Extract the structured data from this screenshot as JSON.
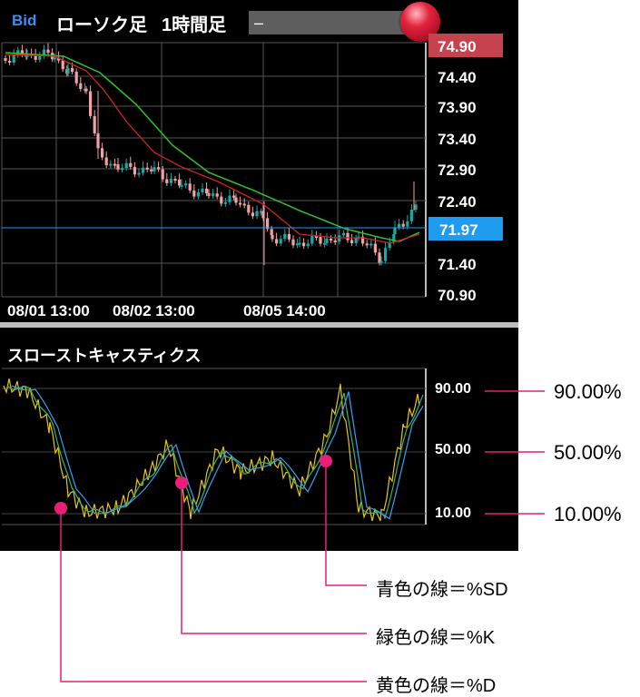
{
  "header": {
    "bid_label": "Bid",
    "chart_type": "ローソク足",
    "timeframe": "1時間足",
    "instrument_value": "–"
  },
  "colors": {
    "ask_line": "#c5424e",
    "current_price": "#1f9bf0",
    "ma_short": "#d42020",
    "ma_long": "#2fc12f",
    "stoch_d": "#e8c414",
    "stoch_k": "#2fb86e",
    "stoch_sd": "#3a9ff0",
    "annotation": "#ea1e78"
  },
  "price_chart": {
    "y_ticks": [
      "74.40",
      "73.90",
      "73.40",
      "72.90",
      "72.40",
      "71.40",
      "70.90"
    ],
    "current_ask": "74.90",
    "current_bid": "71.97",
    "x_labels": [
      "08/01 13:00",
      "08/02 13:00",
      "08/05 14:00"
    ]
  },
  "stochastic": {
    "title": "スローストキャスティクス",
    "y_ticks": [
      "90.00",
      "50.00",
      "10.00"
    ]
  },
  "annotations": {
    "callouts": [
      "90.00%",
      "50.00%",
      "10.00%"
    ],
    "legend": [
      "青色の線＝%SD",
      "緑色の線＝%K",
      "黄色の線＝%D"
    ]
  }
}
